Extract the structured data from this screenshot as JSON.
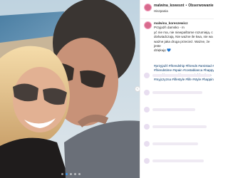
{
  "post": {
    "username": "malwina_kowesnt",
    "follow_label": "Obserwowanie",
    "location": "Hiszpania",
    "caption_user": "malwina_koreszewicz",
    "caption_lines": [
      "Przyjaźń damsko - m",
      "yć nie ma, nie niewpaštome rozumieją. c",
      "doświadczają. Nie ważne ile kwa, nie wa",
      "ważne jaka druga przecież. Ważne, że jeste",
      "dziękuję 💙"
    ],
    "hashtags": [
      "#przyjaźń #friendship #friends #amistad #",
      "#friendstime #spain #costablanca #happy",
      "#goodtime #goodtime #przyjaźń #photo",
      "#myjczyzna #lifestyle #life #style #happin"
    ]
  },
  "carousel": {
    "slides": 5,
    "active_index": 1
  },
  "colors": {
    "accent": "#3897f0",
    "hashtag": "#003569",
    "avatar": "#d86a8d"
  },
  "icons": {
    "prev": "chevron-left-icon"
  }
}
